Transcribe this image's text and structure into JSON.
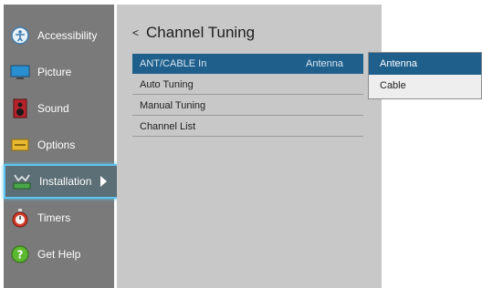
{
  "sidebar": {
    "items": [
      {
        "label": "Accessibility",
        "icon": "accessibility-icon"
      },
      {
        "label": "Picture",
        "icon": "picture-icon"
      },
      {
        "label": "Sound",
        "icon": "sound-icon"
      },
      {
        "label": "Options",
        "icon": "options-icon"
      },
      {
        "label": "Installation",
        "icon": "installation-icon",
        "selected": true
      },
      {
        "label": "Timers",
        "icon": "timers-icon"
      },
      {
        "label": "Get Help",
        "icon": "get-help-icon"
      }
    ]
  },
  "panel": {
    "back_glyph": "<",
    "title": "Channel Tuning",
    "rows": [
      {
        "label": "ANT/CABLE In",
        "value": "Antenna"
      },
      {
        "label": "Auto Tuning"
      },
      {
        "label": "Manual Tuning"
      },
      {
        "label": "Channel List"
      }
    ]
  },
  "dropdown": {
    "options": [
      "Antenna",
      "Cable"
    ],
    "selected": "Antenna"
  },
  "colors": {
    "sidebar_bg": "#7a7a7a",
    "panel_bg": "#c8c8c8",
    "highlight": "#1f5f8c",
    "focus_ring": "#5ec6f0"
  }
}
